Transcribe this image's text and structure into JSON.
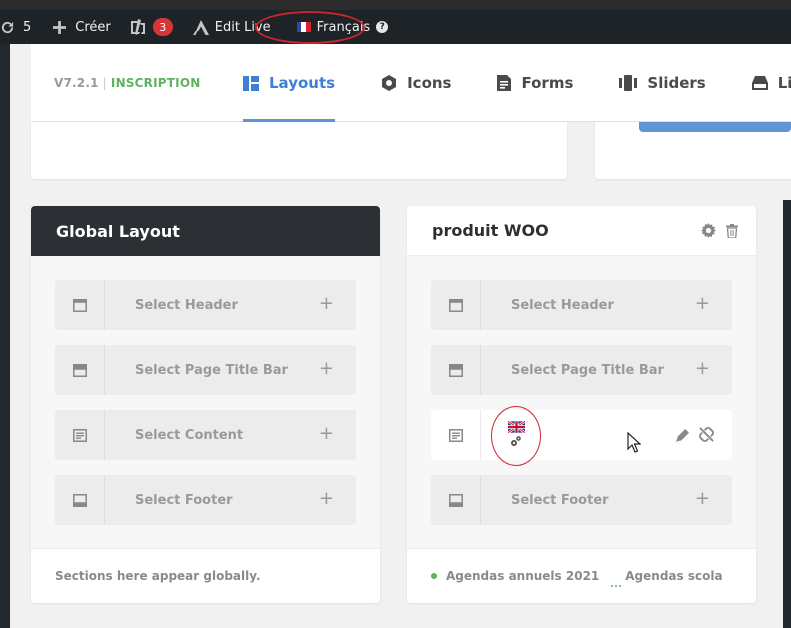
{
  "adminbar": {
    "updates_count": "5",
    "create_label": "Créer",
    "yoast_count": "3",
    "edit_live_label": "Edit Live",
    "language_label": "Français"
  },
  "nav": {
    "version": "V7.2.1",
    "separator": "|",
    "registration": "INSCRIPTION",
    "tabs": [
      {
        "label": "Layouts",
        "icon": "layouts-icon",
        "active": true
      },
      {
        "label": "Icons",
        "icon": "icons-icon"
      },
      {
        "label": "Forms",
        "icon": "forms-icon"
      },
      {
        "label": "Sliders",
        "icon": "sliders-icon"
      },
      {
        "label": "Libr",
        "icon": "library-icon"
      }
    ]
  },
  "global_layout": {
    "title": "Global Layout",
    "slots": [
      {
        "label": "Select Header",
        "icon": "header-icon"
      },
      {
        "label": "Select Page Title Bar",
        "icon": "title-bar-icon"
      },
      {
        "label": "Select Content",
        "icon": "content-icon"
      },
      {
        "label": "Select Footer",
        "icon": "footer-icon"
      }
    ],
    "footer_text": "Sections here appear globally."
  },
  "woo_layout": {
    "title": "produit WOO",
    "slots": [
      {
        "label": "Select Header",
        "icon": "header-icon"
      },
      {
        "label": "Select Page Title Bar",
        "icon": "title-bar-icon"
      },
      {
        "label": "",
        "icon": "content-icon"
      },
      {
        "label": "Select Footer",
        "icon": "footer-icon"
      }
    ],
    "conditions": [
      "Agendas annuels 2021",
      "Agendas scola"
    ]
  },
  "colors": {
    "accent": "#5f95d8",
    "registered": "#5fb35f",
    "admin_bar": "#1d2327",
    "highlight_ring": "#c9262f"
  }
}
